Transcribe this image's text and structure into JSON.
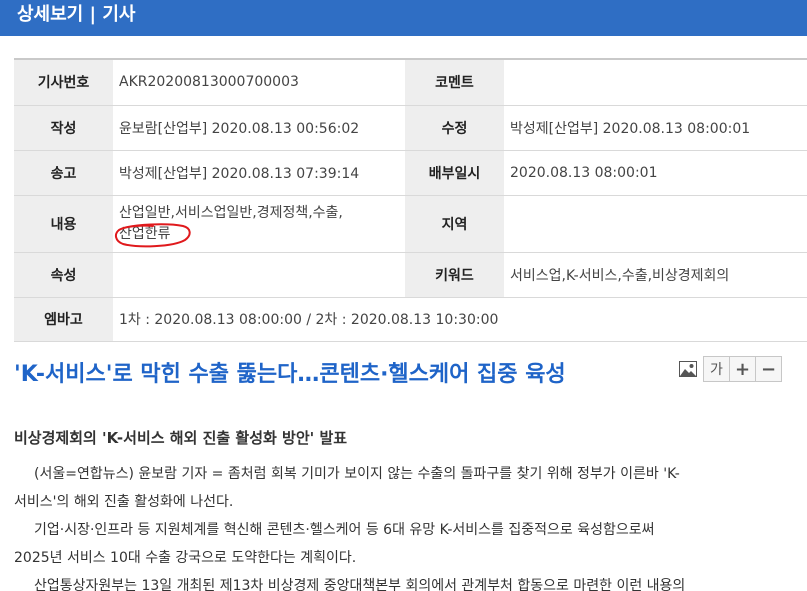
{
  "header": {
    "title": "상세보기 | 기사"
  },
  "meta": {
    "article_no_label": "기사번호",
    "article_no": "AKR20200813000700003",
    "comment_label": "코멘트",
    "comment": "",
    "written_label": "작성",
    "written": "윤보람[산업부] 2020.08.13 00:56:02",
    "modified_label": "수정",
    "modified": "박성제[산업부] 2020.08.13 08:00:01",
    "sent_label": "송고",
    "sent": "박성제[산업부] 2020.08.13 07:39:14",
    "distributed_label": "배부일시",
    "distributed": "2020.08.13 08:00:01",
    "content_label": "내용",
    "content_line1": "산업일반,서비스업일반,경제정책,수출,",
    "content_line2": "산업한류",
    "region_label": "지역",
    "region": "",
    "attribute_label": "속성",
    "attribute": "",
    "keyword_label": "키워드",
    "keyword": "서비스업,K-서비스,수출,비상경제회의",
    "embargo_label": "엠바고",
    "embargo": "1차 : 2020.08.13 08:00:00 / 2차 : 2020.08.13 10:30:00"
  },
  "article": {
    "title": "'K-서비스'로 막힌 수출 뚫는다…콘텐츠·헬스케어 집중 육성",
    "subtitle": "비상경제회의 'K-서비스 해외 진출 활성화 방안' 발표",
    "p1a": "(서울=연합뉴스) 윤보람 기자 = 좀처럼 회복 기미가 보이지 않는 수출의 돌파구를 찾기 위해 정부가 이른바 'K-",
    "p1b": "서비스'의 해외 진출 활성화에 나선다.",
    "p2a": "기업·시장·인프라 등 지원체계를 혁신해 콘텐츠·헬스케어 등 6대 유망 K-서비스를 집중적으로 육성함으로써",
    "p2b": "2025년 서비스 10대 수출 강국으로 도약한다는 계획이다.",
    "p3a": "산업통상자원부는 13일 개최된 제13차 비상경제 중앙대책본부 회의에서 관계부처 합동으로 마련한 이런 내용의"
  },
  "tools": {
    "font_label": "가",
    "plus": "+",
    "minus": "−"
  },
  "colors": {
    "header_bg": "#2f6ec4",
    "title": "#1f64c8",
    "key_bg": "#eeeeee",
    "scribble": "#e0191c"
  }
}
